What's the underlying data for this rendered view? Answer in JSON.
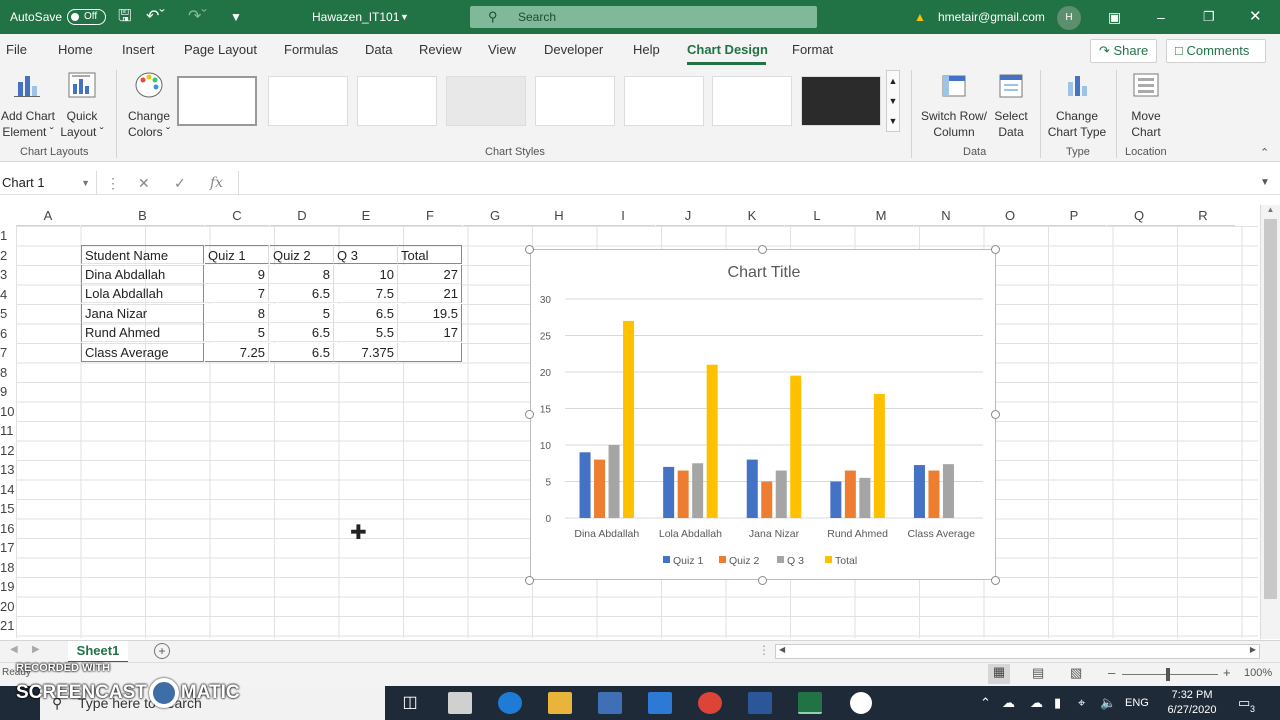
{
  "titlebar": {
    "autosave_label": "AutoSave",
    "autosave_state": "Off",
    "doc_title": "Hawazen_IT101",
    "search_placeholder": "Search",
    "account_email": "hmetair@gmail.com",
    "avatar_initial": "H",
    "accent_color": "#217346"
  },
  "menu": {
    "items": [
      "File",
      "Home",
      "Insert",
      "Page Layout",
      "Formulas",
      "Data",
      "Review",
      "View",
      "Developer",
      "Help",
      "Chart Design",
      "Format"
    ],
    "active": "Chart Design",
    "share": "Share",
    "comments": "Comments"
  },
  "ribbon": {
    "add_chart_element": [
      "Add Chart",
      "Element"
    ],
    "quick_layout": [
      "Quick",
      "Layout"
    ],
    "change_colors": [
      "Change",
      "Colors"
    ],
    "switch_row_column": [
      "Switch Row/",
      "Column"
    ],
    "select_data": [
      "Select",
      "Data"
    ],
    "change_chart_type": [
      "Change",
      "Chart Type"
    ],
    "move_chart": [
      "Move",
      "Chart"
    ],
    "groups": {
      "chart_layouts": "Chart Layouts",
      "chart_styles": "Chart Styles",
      "data": "Data",
      "type": "Type",
      "location": "Location"
    }
  },
  "formula_bar": {
    "name_box": "Chart 1",
    "fx": "fx",
    "content": ""
  },
  "grid": {
    "columns": [
      "A",
      "B",
      "C",
      "D",
      "E",
      "F",
      "G",
      "H",
      "I",
      "J",
      "K",
      "L",
      "M",
      "N",
      "O",
      "P",
      "Q",
      "R"
    ],
    "rows": [
      "1",
      "2",
      "3",
      "4",
      "5",
      "6",
      "7",
      "8",
      "9",
      "10",
      "11",
      "12",
      "13",
      "14",
      "15",
      "16",
      "17",
      "18",
      "19",
      "20",
      "21"
    ],
    "table": {
      "headers": [
        "Student Name",
        "Quiz 1",
        "Quiz 2",
        "Q 3",
        "Total"
      ],
      "rows": [
        [
          "Dina Abdallah",
          "9",
          "8",
          "10",
          "27"
        ],
        [
          "Lola Abdallah",
          "7",
          "6.5",
          "7.5",
          "21"
        ],
        [
          "Jana Nizar",
          "8",
          "5",
          "6.5",
          "19.5"
        ],
        [
          "Rund Ahmed",
          "5",
          "6.5",
          "5.5",
          "17"
        ],
        [
          "Class Average",
          "7.25",
          "6.5",
          "7.375",
          ""
        ]
      ]
    }
  },
  "chart_data": {
    "type": "bar",
    "title": "Chart Title",
    "categories": [
      "Dina Abdallah",
      "Lola Abdallah",
      "Jana Nizar",
      "Rund Ahmed",
      "Class Average"
    ],
    "series": [
      {
        "name": "Quiz 1",
        "values": [
          9,
          7,
          8,
          5,
          7.25
        ],
        "color": "#4472c4"
      },
      {
        "name": "Quiz 2",
        "values": [
          8,
          6.5,
          5,
          6.5,
          6.5
        ],
        "color": "#ed7d31"
      },
      {
        "name": "Q 3",
        "values": [
          10,
          7.5,
          6.5,
          5.5,
          7.375
        ],
        "color": "#a5a5a5"
      },
      {
        "name": "Total",
        "values": [
          27,
          21,
          19.5,
          17,
          0
        ],
        "color": "#ffc000"
      }
    ],
    "yticks": [
      "0",
      "5",
      "10",
      "15",
      "20",
      "25",
      "30"
    ],
    "ylim": [
      0,
      30
    ],
    "grid": true,
    "legend_position": "bottom"
  },
  "sheets": {
    "active": "Sheet1"
  },
  "status": {
    "ready": "Ready",
    "zoom": "100%"
  },
  "taskbar": {
    "search_placeholder": "Type here to search",
    "time": "7:32 PM",
    "date": "6/27/2020",
    "lang": "ENG",
    "notifications": "3"
  },
  "watermark": {
    "line1": "RECORDED WITH",
    "line2a": "SCREENCAST",
    "line2b": "MATIC"
  }
}
